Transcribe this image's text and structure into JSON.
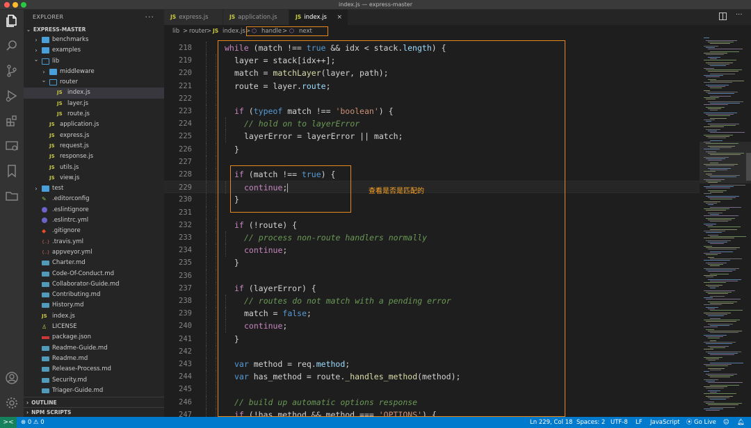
{
  "window": {
    "title": "index.js — express-master"
  },
  "sidebar": {
    "header": "EXPLORER",
    "more": "···",
    "project": "EXPRESS-MASTER",
    "tree": [
      {
        "label": "benchmarks",
        "type": "folder",
        "depth": 1,
        "expanded": false
      },
      {
        "label": "examples",
        "type": "folder",
        "depth": 1,
        "expanded": false
      },
      {
        "label": "lib",
        "type": "folder",
        "depth": 1,
        "expanded": true
      },
      {
        "label": "middleware",
        "type": "folder",
        "depth": 2,
        "expanded": false
      },
      {
        "label": "router",
        "type": "folder",
        "depth": 2,
        "expanded": true
      },
      {
        "label": "index.js",
        "type": "js",
        "depth": 3,
        "selected": true
      },
      {
        "label": "layer.js",
        "type": "js",
        "depth": 3
      },
      {
        "label": "route.js",
        "type": "js",
        "depth": 3
      },
      {
        "label": "application.js",
        "type": "js",
        "depth": 2
      },
      {
        "label": "express.js",
        "type": "js",
        "depth": 2
      },
      {
        "label": "request.js",
        "type": "js",
        "depth": 2
      },
      {
        "label": "response.js",
        "type": "js",
        "depth": 2
      },
      {
        "label": "utils.js",
        "type": "js",
        "depth": 2
      },
      {
        "label": "view.js",
        "type": "js",
        "depth": 2
      },
      {
        "label": "test",
        "type": "folder",
        "depth": 1,
        "expanded": false
      },
      {
        "label": ".editorconfig",
        "type": "config",
        "depth": 1
      },
      {
        "label": ".eslintignore",
        "type": "eslint",
        "depth": 1
      },
      {
        "label": ".eslintrc.yml",
        "type": "eslint",
        "depth": 1
      },
      {
        "label": ".gitignore",
        "type": "git",
        "depth": 1
      },
      {
        "label": ".travis.yml",
        "type": "yml",
        "depth": 1
      },
      {
        "label": "appveyor.yml",
        "type": "yml",
        "depth": 1
      },
      {
        "label": "Charter.md",
        "type": "md",
        "depth": 1
      },
      {
        "label": "Code-Of-Conduct.md",
        "type": "md",
        "depth": 1
      },
      {
        "label": "Collaborator-Guide.md",
        "type": "md",
        "depth": 1
      },
      {
        "label": "Contributing.md",
        "type": "md",
        "depth": 1
      },
      {
        "label": "History.md",
        "type": "md",
        "depth": 1
      },
      {
        "label": "index.js",
        "type": "js",
        "depth": 1
      },
      {
        "label": "LICENSE",
        "type": "license",
        "depth": 1
      },
      {
        "label": "package.json",
        "type": "npm",
        "depth": 1
      },
      {
        "label": "Readme-Guide.md",
        "type": "md",
        "depth": 1
      },
      {
        "label": "Readme.md",
        "type": "md",
        "depth": 1
      },
      {
        "label": "Release-Process.md",
        "type": "md",
        "depth": 1
      },
      {
        "label": "Security.md",
        "type": "md",
        "depth": 1
      },
      {
        "label": "Triager-Guide.md",
        "type": "md",
        "depth": 1
      }
    ],
    "outline": "OUTLINE",
    "npm_scripts": "NPM SCRIPTS"
  },
  "tabs": [
    {
      "label": "express.js",
      "badge": "JS",
      "active": false
    },
    {
      "label": "application.js",
      "badge": "JS",
      "active": false
    },
    {
      "label": "index.js",
      "badge": "JS",
      "active": true,
      "close": "×"
    }
  ],
  "breadcrumbs": {
    "items": [
      "lib",
      "router",
      "index.js",
      "handle",
      "next"
    ],
    "badge": "JS",
    "sep": ">"
  },
  "editor": {
    "lines": [
      {
        "n": "218",
        "indent": 0,
        "tokens": [
          [
            "kw",
            "while"
          ],
          [
            "vr",
            " (match "
          ],
          [
            "vr",
            "!=="
          ],
          [
            "kw2",
            " true"
          ],
          [
            "vr",
            " && idx < stack."
          ],
          [
            "prop",
            "length"
          ],
          [
            "vr",
            ") {"
          ]
        ]
      },
      {
        "n": "219",
        "indent": 1,
        "tokens": [
          [
            "vr",
            "layer = stack[idx++];"
          ]
        ]
      },
      {
        "n": "220",
        "indent": 1,
        "tokens": [
          [
            "vr",
            "match = "
          ],
          [
            "fn",
            "matchLayer"
          ],
          [
            "vr",
            "(layer, path);"
          ]
        ]
      },
      {
        "n": "221",
        "indent": 1,
        "tokens": [
          [
            "vr",
            "route = layer."
          ],
          [
            "prop",
            "route"
          ],
          [
            "vr",
            ";"
          ]
        ]
      },
      {
        "n": "222",
        "indent": 1,
        "tokens": []
      },
      {
        "n": "223",
        "indent": 1,
        "tokens": [
          [
            "kw",
            "if"
          ],
          [
            "vr",
            " ("
          ],
          [
            "kw2",
            "typeof"
          ],
          [
            "vr",
            " match !== "
          ],
          [
            "str",
            "'boolean'"
          ],
          [
            "vr",
            ") {"
          ]
        ]
      },
      {
        "n": "224",
        "indent": 2,
        "tokens": [
          [
            "cm",
            "// hold on to layerError"
          ]
        ]
      },
      {
        "n": "225",
        "indent": 2,
        "tokens": [
          [
            "vr",
            "layerError = layerError || match;"
          ]
        ]
      },
      {
        "n": "226",
        "indent": 1,
        "tokens": [
          [
            "vr",
            "}"
          ]
        ]
      },
      {
        "n": "227",
        "indent": 1,
        "tokens": []
      },
      {
        "n": "228",
        "indent": 1,
        "tokens": [
          [
            "kw",
            "if"
          ],
          [
            "vr",
            " (match !== "
          ],
          [
            "kw2",
            "true"
          ],
          [
            "vr",
            ") {"
          ]
        ]
      },
      {
        "n": "229",
        "indent": 2,
        "tokens": [
          [
            "kw",
            "continue"
          ],
          [
            "vr",
            ";"
          ]
        ],
        "cursor": true
      },
      {
        "n": "230",
        "indent": 1,
        "tokens": [
          [
            "vr",
            "}"
          ]
        ]
      },
      {
        "n": "231",
        "indent": 1,
        "tokens": []
      },
      {
        "n": "232",
        "indent": 1,
        "tokens": [
          [
            "kw",
            "if"
          ],
          [
            "vr",
            " (!route) {"
          ]
        ]
      },
      {
        "n": "233",
        "indent": 2,
        "tokens": [
          [
            "cm",
            "// process non-route handlers normally"
          ]
        ]
      },
      {
        "n": "234",
        "indent": 2,
        "tokens": [
          [
            "kw",
            "continue"
          ],
          [
            "vr",
            ";"
          ]
        ]
      },
      {
        "n": "235",
        "indent": 1,
        "tokens": [
          [
            "vr",
            "}"
          ]
        ]
      },
      {
        "n": "236",
        "indent": 1,
        "tokens": []
      },
      {
        "n": "237",
        "indent": 1,
        "tokens": [
          [
            "kw",
            "if"
          ],
          [
            "vr",
            " (layerError) {"
          ]
        ]
      },
      {
        "n": "238",
        "indent": 2,
        "tokens": [
          [
            "cm",
            "// routes do not match with a pending error"
          ]
        ]
      },
      {
        "n": "239",
        "indent": 2,
        "tokens": [
          [
            "vr",
            "match = "
          ],
          [
            "kw2",
            "false"
          ],
          [
            "vr",
            ";"
          ]
        ]
      },
      {
        "n": "240",
        "indent": 2,
        "tokens": [
          [
            "kw",
            "continue"
          ],
          [
            "vr",
            ";"
          ]
        ]
      },
      {
        "n": "241",
        "indent": 1,
        "tokens": [
          [
            "vr",
            "}"
          ]
        ]
      },
      {
        "n": "242",
        "indent": 1,
        "tokens": []
      },
      {
        "n": "243",
        "indent": 1,
        "tokens": [
          [
            "kw2",
            "var"
          ],
          [
            "vr",
            " method = req."
          ],
          [
            "prop",
            "method"
          ],
          [
            "vr",
            ";"
          ]
        ]
      },
      {
        "n": "244",
        "indent": 1,
        "tokens": [
          [
            "kw2",
            "var"
          ],
          [
            "vr",
            " has_method = route."
          ],
          [
            "fn",
            "_handles_method"
          ],
          [
            "vr",
            "(method);"
          ]
        ]
      },
      {
        "n": "245",
        "indent": 1,
        "tokens": []
      },
      {
        "n": "246",
        "indent": 1,
        "tokens": [
          [
            "cm",
            "// build up automatic options response"
          ]
        ]
      },
      {
        "n": "247",
        "indent": 1,
        "tokens": [
          [
            "kw",
            "if"
          ],
          [
            "vr",
            " (!has_method && method === "
          ],
          [
            "str",
            "'OPTIONS'"
          ],
          [
            "vr",
            ") {"
          ]
        ]
      }
    ],
    "annotation": "查看是否是匹配的"
  },
  "status": {
    "remote_icon": "><",
    "problems": "⊗ 0 ⚠ 0",
    "position": "Ln 229, Col 18",
    "spaces": "Spaces: 2",
    "encoding": "UTF-8",
    "eol": "LF",
    "language": "JavaScript",
    "golive": "Go Live"
  },
  "colors": {
    "accent": "#007acc",
    "highlight": "#e8891d",
    "annotation": "#ffa726"
  }
}
